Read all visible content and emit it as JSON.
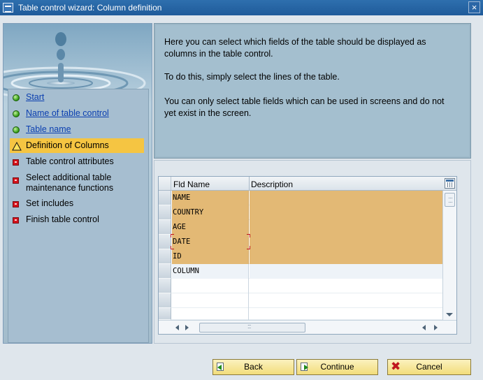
{
  "window": {
    "title": "Table control wizard: Column definition",
    "close_label": "×"
  },
  "steps": [
    {
      "label": "Start",
      "status": "done",
      "link": true
    },
    {
      "label": "Name of table control",
      "status": "done",
      "link": true
    },
    {
      "label": "Table name",
      "status": "done",
      "link": true
    },
    {
      "label": "Definition of Columns",
      "status": "current",
      "link": false
    },
    {
      "label": "Table control attributes",
      "status": "pending",
      "link": false
    },
    {
      "label": "Select additional table maintenance functions",
      "status": "pending",
      "link": false
    },
    {
      "label": "Set includes",
      "status": "pending",
      "link": false
    },
    {
      "label": "Finish table control",
      "status": "pending",
      "link": false
    }
  ],
  "info": {
    "p1": "Here you can select which fields of the table should be displayed as columns in the table control.",
    "p2": "To do this, simply select the lines of the table.",
    "p3": "You can only select table fields which can be used in screens and do not yet exist in the screen."
  },
  "table": {
    "columns": [
      "Fld Name",
      "Description"
    ],
    "rows": [
      {
        "name": "NAME",
        "description": "",
        "selected": true
      },
      {
        "name": "COUNTRY",
        "description": "",
        "selected": true
      },
      {
        "name": "AGE",
        "description": "",
        "selected": true
      },
      {
        "name": "DATE",
        "description": "",
        "selected": true
      },
      {
        "name": "ID",
        "description": "",
        "selected": true
      },
      {
        "name": "COLUMN",
        "description": "",
        "selected": false
      },
      {
        "name": "",
        "description": "",
        "selected": false
      },
      {
        "name": "",
        "description": "",
        "selected": false
      },
      {
        "name": "",
        "description": "",
        "selected": false
      }
    ]
  },
  "buttons": {
    "back": "Back",
    "continue": "Continue",
    "cancel": "Cancel"
  },
  "colors": {
    "selected_row": "#e3b975",
    "current_step": "#f5c542",
    "panel": "#a4bfcf",
    "title_bar": "#1f5b9a"
  },
  "icons": {
    "done": "green-led-icon",
    "current": "yellow-triangle-icon",
    "pending": "red-square-icon"
  }
}
